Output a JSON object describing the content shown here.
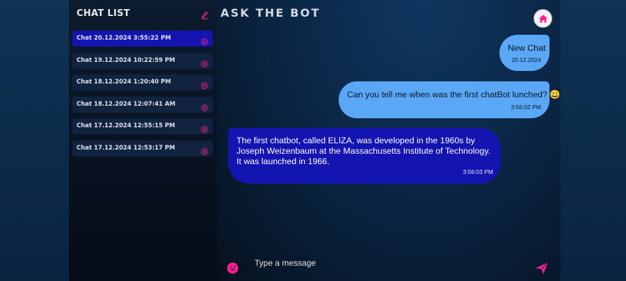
{
  "sidebar": {
    "title": "CHAT LIST",
    "items": [
      {
        "label": "Chat 20.12.2024 3:55:22 PM",
        "active": true
      },
      {
        "label": "Chat 19.12.2024 10:22:59 PM",
        "active": false
      },
      {
        "label": "Chat 18.12.2024 1:20:40 PM",
        "active": false
      },
      {
        "label": "Chat 18.12.2024 12:07:41 AM",
        "active": false
      },
      {
        "label": "Chat 17.12.2024 12:55:15 PM",
        "active": false
      },
      {
        "label": "Chat 17.12.2024 12:53:17 PM",
        "active": false
      }
    ]
  },
  "header": {
    "title": "ASK THE BOT"
  },
  "messages": [
    {
      "sender": "user",
      "text": "New Chat",
      "time": "20.12.2024"
    },
    {
      "sender": "user",
      "text": "Can you tell me when was the first chatBot lunched? 😀",
      "time": "3:56:02 PM"
    },
    {
      "sender": "bot",
      "text": "The first chatbot, called ELIZA, was developed in the 1960s by Joseph Weizenbaum at the Massachusetts Institute of Technology. It was launched in 1966.",
      "time": "3:56:03 PM"
    }
  ],
  "composer": {
    "placeholder": "Type a message",
    "value": ""
  },
  "colors": {
    "accent": "#ff1f8e",
    "active_chat": "#1414b0",
    "user_bubble": "#5aa8f5",
    "bot_bubble": "#1414b0"
  },
  "icons": {
    "new_chat": "edit-icon",
    "delete_chat": "close-circle-icon",
    "home": "home-icon",
    "emoji": "smiley-icon",
    "send": "send-icon"
  }
}
